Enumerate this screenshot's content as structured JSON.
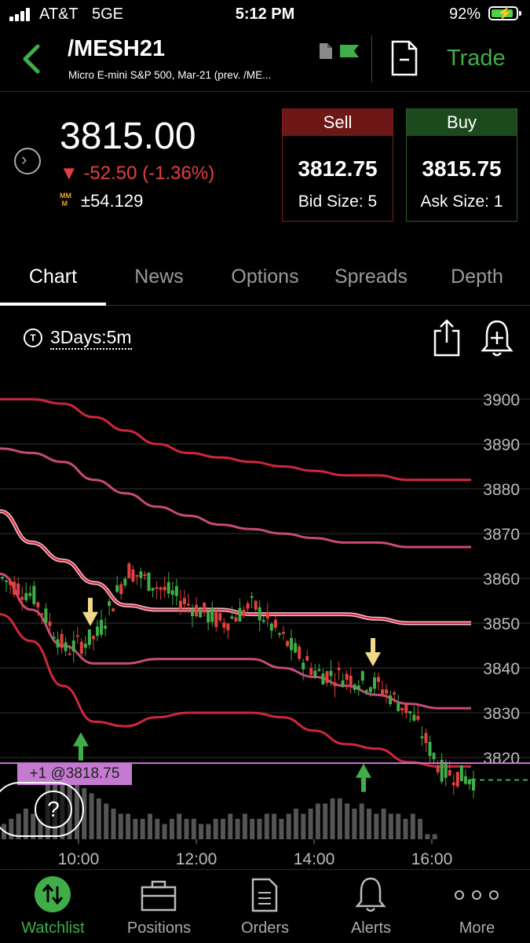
{
  "status_bar": {
    "carrier": "AT&T",
    "network": "5GE",
    "time": "5:12 PM",
    "battery": "92%"
  },
  "header": {
    "symbol": "/MESH21",
    "description": "Micro E-mini S&P 500, Mar-21 (prev. /ME...",
    "trade_label": "Trade"
  },
  "quote": {
    "last": "3815.00",
    "change": "-52.50 (-1.36%)",
    "mm_icon": "MM M",
    "mm_value": "±54.129",
    "sell": {
      "label": "Sell",
      "price": "3812.75",
      "size": "Bid Size: 5"
    },
    "buy": {
      "label": "Buy",
      "price": "3815.75",
      "size": "Ask Size: 1"
    }
  },
  "tabs": [
    "Chart",
    "News",
    "Options",
    "Spreads",
    "Depth"
  ],
  "chart_toolbar": {
    "t_icon": "T",
    "period": "3Days:5m"
  },
  "chart": {
    "position_label": "+1 @3818.75",
    "help_label": "?"
  },
  "chart_data": {
    "type": "line",
    "y_ticks": [
      "3900",
      "3890",
      "3880",
      "3870",
      "3860",
      "3850",
      "3840",
      "3830",
      "3820"
    ],
    "x_ticks": [
      "10:00",
      "12:00",
      "14:00",
      "16:00"
    ],
    "ylim": [
      3814,
      3902
    ],
    "bands": {
      "upper_outer": [
        [
          0,
          3900
        ],
        [
          1,
          3900
        ],
        [
          2,
          3899
        ],
        [
          3,
          3896
        ],
        [
          4,
          3893
        ],
        [
          5,
          3890
        ],
        [
          6,
          3888
        ],
        [
          7,
          3887
        ],
        [
          8,
          3886
        ],
        [
          9,
          3885
        ],
        [
          10,
          3884
        ],
        [
          11,
          3883
        ],
        [
          12,
          3883
        ],
        [
          13,
          3882
        ],
        [
          14,
          3882
        ],
        [
          15,
          3882
        ]
      ],
      "upper_inner": [
        [
          0,
          3889
        ],
        [
          1,
          3888
        ],
        [
          2,
          3886
        ],
        [
          3,
          3882
        ],
        [
          4,
          3879
        ],
        [
          5,
          3876
        ],
        [
          6,
          3874
        ],
        [
          7,
          3872
        ],
        [
          8,
          3871
        ],
        [
          9,
          3870
        ],
        [
          10,
          3869
        ],
        [
          11,
          3868
        ],
        [
          12,
          3868
        ],
        [
          13,
          3867
        ],
        [
          14,
          3867
        ],
        [
          15,
          3867
        ]
      ],
      "middle": [
        [
          0,
          3875
        ],
        [
          1,
          3868
        ],
        [
          2,
          3864
        ],
        [
          3,
          3859
        ],
        [
          4,
          3854
        ],
        [
          5,
          3853
        ],
        [
          6,
          3853
        ],
        [
          7,
          3853
        ],
        [
          8,
          3852
        ],
        [
          9,
          3852
        ],
        [
          10,
          3852
        ],
        [
          11,
          3852
        ],
        [
          12,
          3851
        ],
        [
          13,
          3850
        ],
        [
          14,
          3850
        ],
        [
          15,
          3850
        ]
      ],
      "lower_inner": [
        [
          0,
          3861
        ],
        [
          1,
          3853
        ],
        [
          2,
          3845
        ],
        [
          3,
          3841
        ],
        [
          4,
          3841
        ],
        [
          5,
          3842
        ],
        [
          6,
          3842
        ],
        [
          7,
          3842
        ],
        [
          8,
          3842
        ],
        [
          9,
          3840
        ],
        [
          10,
          3838
        ],
        [
          11,
          3836
        ],
        [
          12,
          3834
        ],
        [
          13,
          3832
        ],
        [
          14,
          3831
        ],
        [
          15,
          3831
        ]
      ],
      "lower_outer": [
        [
          0,
          3852
        ],
        [
          1,
          3846
        ],
        [
          2,
          3836
        ],
        [
          3,
          3828
        ],
        [
          4,
          3827
        ],
        [
          5,
          3829
        ],
        [
          6,
          3830
        ],
        [
          7,
          3830
        ],
        [
          8,
          3830
        ],
        [
          9,
          3829
        ],
        [
          10,
          3826
        ],
        [
          11,
          3823
        ],
        [
          12,
          3822
        ],
        [
          13,
          3819
        ],
        [
          14,
          3818
        ],
        [
          15,
          3818
        ]
      ]
    },
    "price": [
      [
        0,
        3860
      ],
      [
        1,
        3856
      ],
      [
        2,
        3844
      ],
      [
        3,
        3847
      ],
      [
        4,
        3862
      ],
      [
        5,
        3858
      ],
      [
        6,
        3854
      ],
      [
        7,
        3850
      ],
      [
        8,
        3854
      ],
      [
        9,
        3846
      ],
      [
        10,
        3839
      ],
      [
        11,
        3838
      ],
      [
        12,
        3836
      ],
      [
        13,
        3830
      ],
      [
        14,
        3817
      ],
      [
        15,
        3815
      ]
    ],
    "position_price": 3818.75,
    "last_price": 3815.0,
    "markers": [
      {
        "type": "sell-arrow",
        "x": 2.2,
        "price": 3849
      },
      {
        "type": "buy-arrow",
        "x": 1.9,
        "price": 3826
      },
      {
        "type": "sell-arrow",
        "x": 11.2,
        "price": 3840
      },
      {
        "type": "buy-arrow",
        "x": 10.9,
        "price": 3819
      }
    ],
    "volume": [
      3,
      4,
      5,
      6,
      5,
      4,
      12,
      14,
      13,
      12,
      11,
      10,
      9,
      8,
      7,
      6,
      5,
      5,
      4,
      4,
      5,
      4,
      3,
      4,
      5,
      4,
      4,
      3,
      3,
      4,
      4,
      5,
      4,
      5,
      4,
      4,
      5,
      5,
      4,
      5,
      6,
      5,
      6,
      7,
      7,
      8,
      8,
      7,
      6,
      7,
      6,
      5,
      6,
      5,
      5,
      4,
      5,
      4,
      1,
      1
    ]
  },
  "colors": {
    "accent_green": "#3fae49",
    "down_red": "#e34040",
    "band_red": "#d0263e",
    "band_pink": "#c94a78",
    "band_outline": "#f0c0c8",
    "position_line": "#c47ad0"
  },
  "bottom_nav": [
    {
      "label": "Watchlist",
      "icon": "watchlist-icon",
      "active": true
    },
    {
      "label": "Positions",
      "icon": "briefcase-icon"
    },
    {
      "label": "Orders",
      "icon": "document-icon"
    },
    {
      "label": "Alerts",
      "icon": "bell-icon"
    },
    {
      "label": "More",
      "icon": "more-dots-icon"
    }
  ]
}
